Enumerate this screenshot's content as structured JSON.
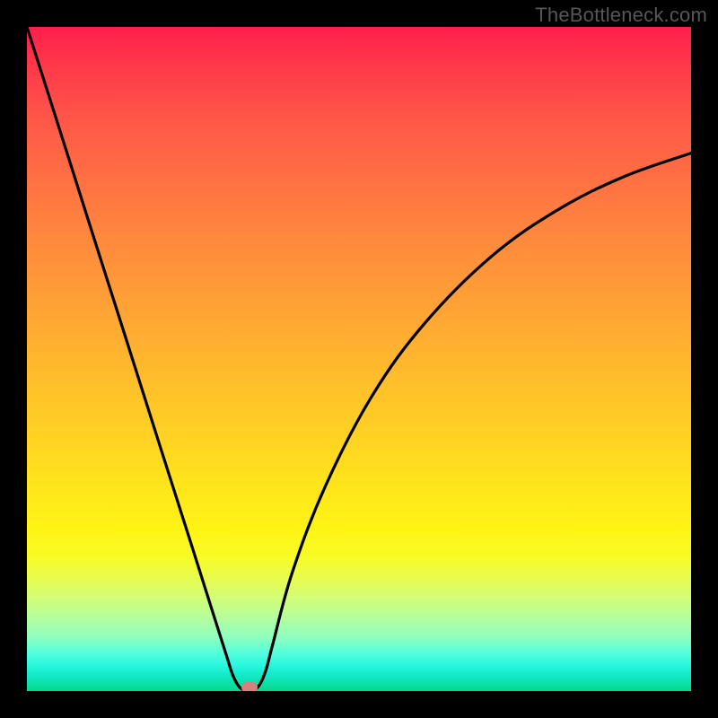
{
  "watermark": "TheBottleneck.com",
  "chart_data": {
    "type": "line",
    "title": "",
    "xlabel": "",
    "ylabel": "",
    "xlim": [
      0,
      100
    ],
    "ylim": [
      0,
      100
    ],
    "grid": false,
    "series": [
      {
        "name": "bottleneck-curve",
        "x": [
          0,
          5,
          10,
          15,
          20,
          25,
          28,
          30,
          31,
          32,
          33,
          34,
          35,
          36,
          37,
          40,
          45,
          52,
          60,
          70,
          80,
          90,
          100
        ],
        "values": [
          100,
          84.3,
          68.5,
          52.8,
          37.0,
          21.3,
          11.8,
          5.5,
          2.4,
          0.6,
          0.1,
          0.1,
          0.9,
          3.2,
          7.0,
          18.0,
          31.0,
          44.5,
          55.5,
          65.5,
          72.5,
          77.5,
          81.0
        ]
      }
    ],
    "annotations": [
      {
        "name": "optimum-marker",
        "x": 33.5,
        "y": 0.5,
        "color": "#d97f7e"
      }
    ],
    "background": {
      "type": "vertical-gradient",
      "stops": [
        {
          "pos": 0,
          "color": "#ff1f4b"
        },
        {
          "pos": 50,
          "color": "#ffbb2c"
        },
        {
          "pos": 78,
          "color": "#fef514"
        },
        {
          "pos": 100,
          "color": "#07d88c"
        }
      ]
    }
  },
  "marker": {
    "color": "#d97f7e"
  }
}
